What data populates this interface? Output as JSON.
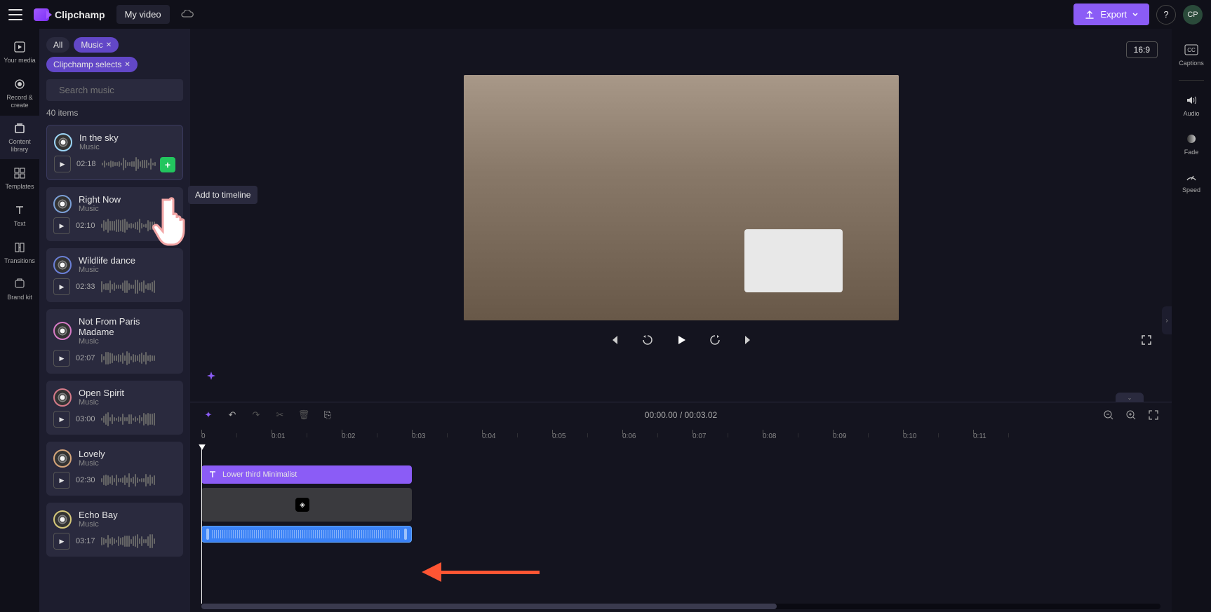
{
  "header": {
    "app_name": "Clipchamp",
    "project_name": "My video",
    "export_label": "Export",
    "avatar_initials": "CP"
  },
  "left_sidebar": {
    "items": [
      {
        "label": "Your media",
        "icon": "media"
      },
      {
        "label": "Record & create",
        "icon": "record"
      },
      {
        "label": "Content library",
        "icon": "library"
      },
      {
        "label": "Templates",
        "icon": "templates"
      },
      {
        "label": "Text",
        "icon": "text"
      },
      {
        "label": "Transitions",
        "icon": "transitions"
      },
      {
        "label": "Brand kit",
        "icon": "brand"
      }
    ]
  },
  "media_panel": {
    "chips": {
      "all": "All",
      "music": "Music",
      "selects": "Clipchamp selects"
    },
    "search_placeholder": "Search music",
    "item_count": "40 items",
    "tooltip": "Add to timeline",
    "tracks": [
      {
        "title": "In the sky",
        "sub": "Music",
        "duration": "02:18",
        "ring": "#9bd4f5",
        "highlighted": true,
        "add_visible": true
      },
      {
        "title": "Right Now",
        "sub": "Music",
        "duration": "02:10",
        "ring": "#7b9fd6"
      },
      {
        "title": "Wildlife dance",
        "sub": "Music",
        "duration": "02:33",
        "ring": "#6a7fd6"
      },
      {
        "title": "Not From Paris Madame",
        "sub": "Music",
        "duration": "02:07",
        "ring": "#d67bc6"
      },
      {
        "title": "Open Spirit",
        "sub": "Music",
        "duration": "03:00",
        "ring": "#d67b8a"
      },
      {
        "title": "Lovely",
        "sub": "Music",
        "duration": "02:30",
        "ring": "#d6a67b"
      },
      {
        "title": "Echo Bay",
        "sub": "Music",
        "duration": "03:17",
        "ring": "#d6c97b"
      }
    ]
  },
  "preview": {
    "aspect": "16:9"
  },
  "timeline": {
    "time_current": "00:00.00",
    "time_total": "00:03.02",
    "ticks": [
      "0",
      "0:01",
      "0:02",
      "0:03",
      "0:04",
      "0:05",
      "0:06",
      "0:07",
      "0:08",
      "0:09",
      "0:10",
      "0:11"
    ],
    "text_clip_label": "Lower third Minimalist"
  },
  "right_sidebar": {
    "items": [
      {
        "label": "Captions",
        "icon": "captions"
      },
      {
        "label": "Audio",
        "icon": "audio"
      },
      {
        "label": "Fade",
        "icon": "fade"
      },
      {
        "label": "Speed",
        "icon": "speed"
      }
    ]
  }
}
